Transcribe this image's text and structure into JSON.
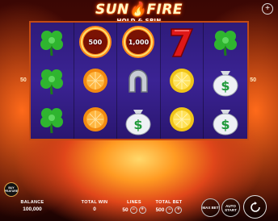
{
  "game": {
    "logo_main": "SUN🔥FIRE",
    "logo_sub": "HOLD & SPIN",
    "lines_marker": "50",
    "menu_icon": "+"
  },
  "reels": [
    [
      "clover",
      "clover",
      "clover"
    ],
    [
      "fireball",
      "orange",
      "orange"
    ],
    [
      "fireball",
      "horseshoe",
      "dollar-bag"
    ],
    [
      "seven",
      "lemon",
      "lemon"
    ],
    [
      "clover",
      "dollar-bag",
      "dollar-bag"
    ]
  ],
  "fireballs": {
    "reel2": "500",
    "reel3": "1,000"
  },
  "hud": {
    "balance_label": "BALANCE",
    "balance_value": "100,000",
    "total_win_label": "TOTAL WIN",
    "total_win_value": "0",
    "lines_label": "LINES",
    "lines_value": "50",
    "total_bet_label": "TOTAL BET",
    "total_bet_value": "500",
    "minus": "−",
    "plus": "+",
    "max_bet": "MAX BET",
    "auto_start": "AUTO START",
    "buy_feature": "BUY FEATURE"
  },
  "colors": {
    "reel_bg": "#3b2394",
    "frame": "#c24a14",
    "accent": "#ff6a00"
  }
}
